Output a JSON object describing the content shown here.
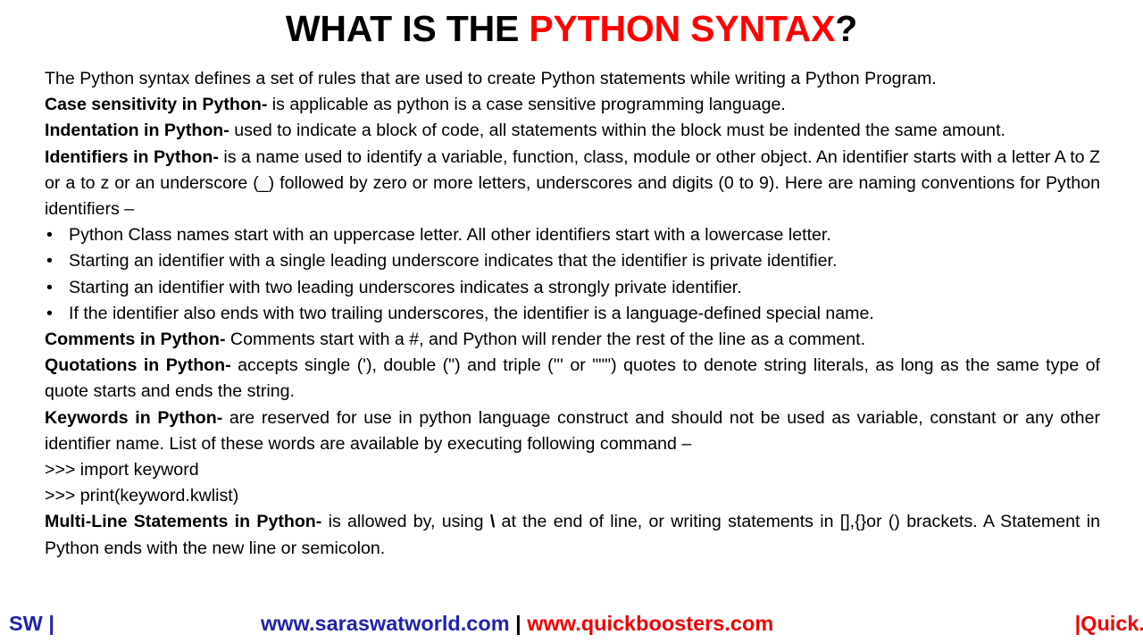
{
  "title": {
    "part1": "WHAT IS THE ",
    "part2": "PYTHON SYNTAX",
    "part3": "?",
    "accent_color": "#FF0000",
    "base_color": "#000000"
  },
  "content": {
    "intro": "The Python syntax defines a set of rules that are used to create Python statements while writing a Python Program.",
    "case_sensitivity": {
      "label": "Case sensitivity in Python-",
      "text": "  is applicable as python is a case sensitive programming language."
    },
    "indentation": {
      "label": "Indentation in Python-",
      "text": " used to indicate a block of code, all statements within the block must be indented the same amount."
    },
    "identifiers": {
      "label": "Identifiers in Python-",
      "text": " is a name used to identify a variable, function, class, module or other object. An identifier starts with a letter A to Z or a to z or an underscore (_) followed by zero or more letters, underscores and digits (0 to 9). Here are naming conventions for Python identifiers –"
    },
    "bullet_glyph": "•",
    "bullets": [
      "Python Class names start with an uppercase letter. All other identifiers start with a lowercase letter.",
      "Starting an identifier with a single leading underscore indicates that the identifier is private identifier.",
      "Starting an identifier with two leading underscores indicates a strongly private identifier.",
      "If the identifier also ends with two trailing underscores, the identifier is a language-defined special name."
    ],
    "comments": {
      "label": "Comments in Python-",
      "text": " Comments start with a #, and Python will render the rest of the line as a comment."
    },
    "quotations": {
      "label": "Quotations in Python-",
      "text": " accepts single ('), double (\") and triple (''' or \"\"\") quotes to denote string literals, as long as the same type of quote starts and ends the string."
    },
    "keywords": {
      "label": "Keywords in Python-",
      "text": " are reserved for use in python language construct and should not be used as variable, constant or any other identifier name. List of these words are available by executing following command –"
    },
    "code_lines": [
      ">>> import keyword",
      ">>> print(keyword.kwlist)"
    ],
    "multiline": {
      "label": "Multi-Line Statements in Python-",
      "text_before": " is allowed by, using ",
      "backslash": "\\",
      "text_after": " at the end of line, or writing statements in [],{}or () brackets. A Statement in Python ends with the new line or semicolon."
    }
  },
  "footer": {
    "left": "SW |",
    "site1": "www.saraswatworld.com",
    "separator": " | ",
    "site2": "www.quickboosters.com",
    "right": "|Quick.",
    "blue": "#2222AA",
    "red": "#EE0000"
  }
}
